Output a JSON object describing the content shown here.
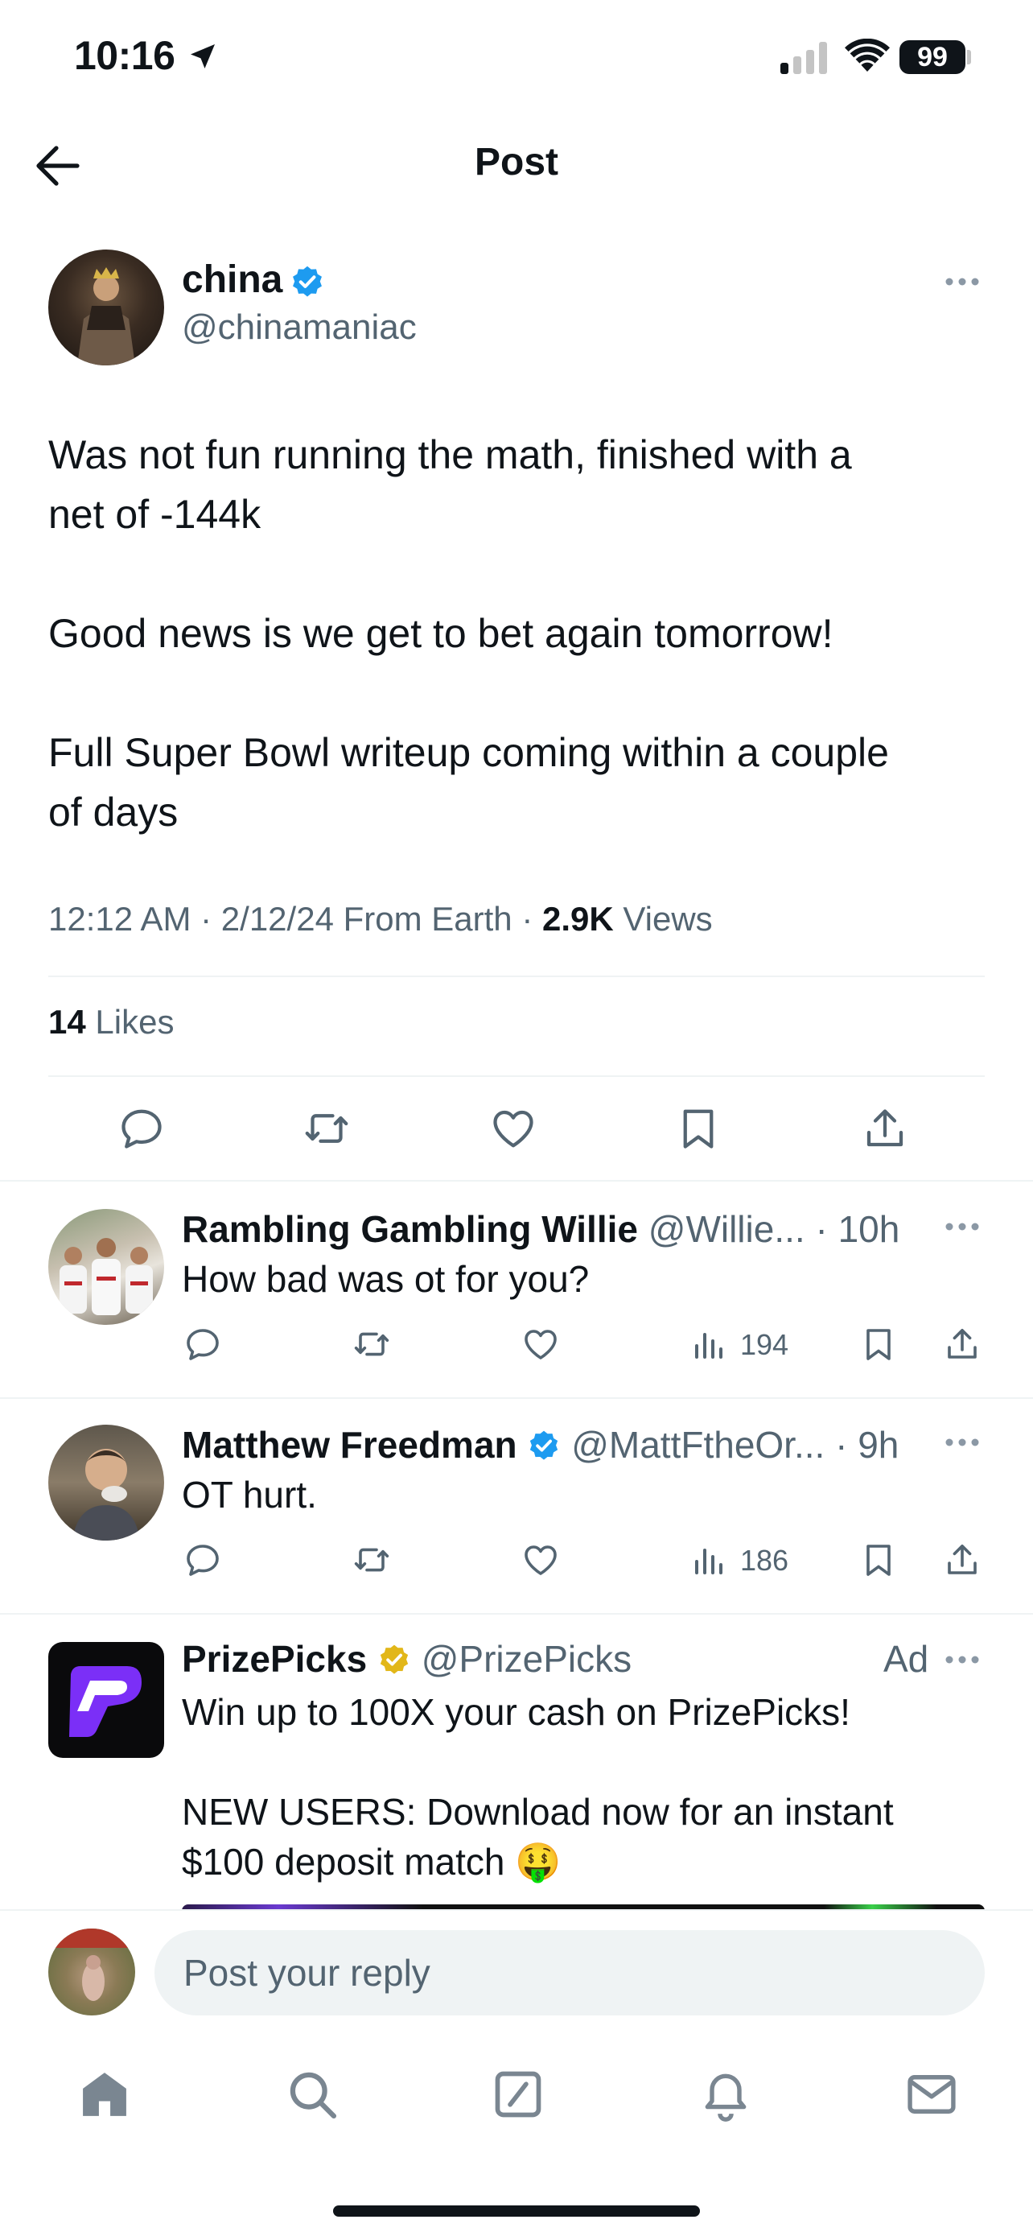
{
  "status_bar": {
    "time": "10:16",
    "battery": "99"
  },
  "header": {
    "title": "Post"
  },
  "post": {
    "author_name": "china",
    "author_handle": "@chinamaniac",
    "text": "Was not fun running the math, finished with a\nnet of -144k\n\nGood news is we get to bet again tomorrow!\n\nFull Super Bowl writeup coming within a couple\nof days",
    "time": "12:12 AM",
    "date": "2/12/24",
    "from": "From Earth",
    "views_count": "2.9K",
    "views_label": "Views",
    "likes_count": "14",
    "likes_label": "Likes"
  },
  "replies": [
    {
      "name": "Rambling Gambling Willie",
      "handle": "@Willie...",
      "time": "10h",
      "text": "How bad was ot for you?",
      "views": "194"
    },
    {
      "name": "Matthew Freedman",
      "handle": "@MattFtheOr...",
      "time": "9h",
      "text": "OT hurt.",
      "views": "186"
    }
  ],
  "ad": {
    "name": "PrizePicks",
    "handle": "@PrizePicks",
    "label": "Ad",
    "text": "Win up to 100X your cash on PrizePicks!\n\nNEW USERS: Download now for an instant\n$100 deposit match 🤑"
  },
  "reply_bar": {
    "placeholder": "Post your reply"
  },
  "colors": {
    "verified_blue": "#1d9bf0",
    "verified_gold": "#e2b719",
    "gray": "#536471",
    "brand_purple": "#7b2ff7"
  }
}
